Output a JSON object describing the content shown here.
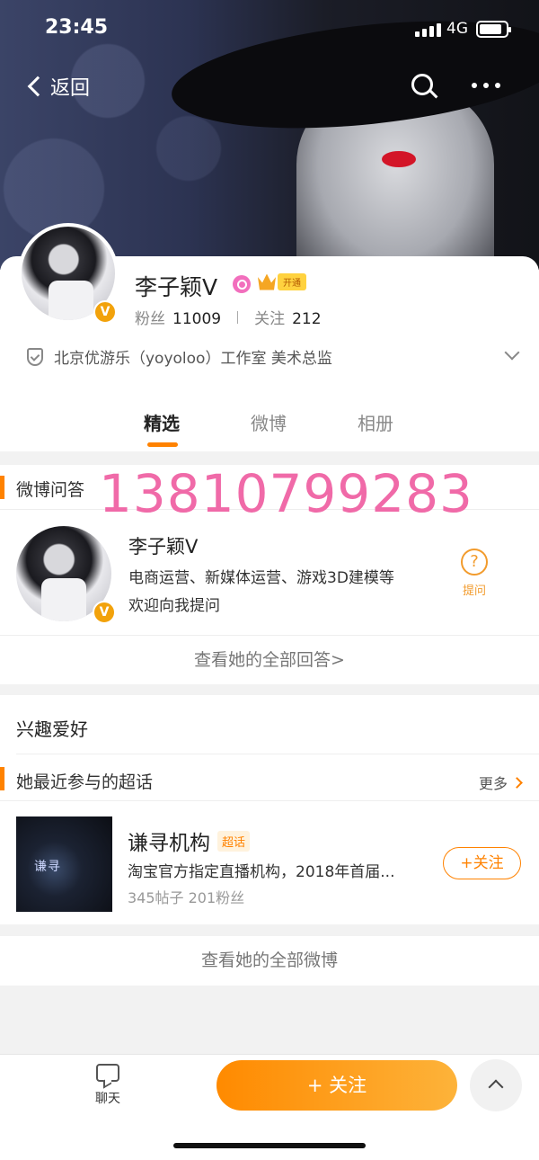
{
  "status_bar": {
    "time": "23:45",
    "network": "4G"
  },
  "nav": {
    "back_label": "返回"
  },
  "profile": {
    "name": "李子颖V",
    "badge_icon": "v-verified-icon",
    "vip_tag": "开通",
    "fans_label": "粉丝",
    "fans_count": "11009",
    "following_label": "关注",
    "following_count": "212",
    "verification": "北京优游乐（yoyoloo）工作室 美术总监"
  },
  "tabs": [
    {
      "label": "精选",
      "active": true
    },
    {
      "label": "微博",
      "active": false
    },
    {
      "label": "相册",
      "active": false
    }
  ],
  "qa": {
    "title": "微博问答",
    "overlay_text": "13810799283",
    "name": "李子颖V",
    "description": "电商运营、新媒体运营、游戏3D建模等 欢迎向我提问",
    "ask_label": "提问",
    "ask_icon": "question-circle-icon",
    "view_all": "查看她的全部回答>"
  },
  "interests": {
    "title": "兴趣爱好",
    "supertopic_title": "她最近参与的超话",
    "more_label": "更多",
    "topic": {
      "name": "谦寻机构",
      "tag": "超话",
      "description": "淘宝官方指定直播机构，2018年首届...",
      "meta": "345帖子 201粉丝",
      "follow_label": "+关注",
      "logo_text": "谦寻"
    }
  },
  "view_all_weibo": "查看她的全部微博",
  "bottom": {
    "chat_label": "聊天",
    "follow_label": "+ 关注"
  },
  "colors": {
    "accent": "#ff8200",
    "overlay_pink": "#f06aa8",
    "verified": "#f2a20b"
  }
}
